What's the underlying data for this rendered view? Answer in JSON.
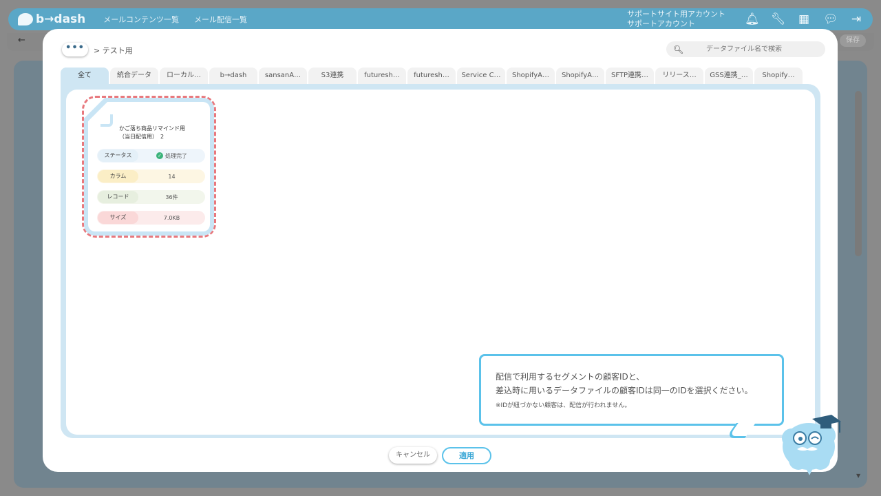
{
  "app": {
    "logo_text": "b→dash",
    "nav": [
      "メールコンテンツ一覧",
      "メール配信一覧"
    ],
    "account_line1": "サポートサイト用アカウント",
    "account_line2": "サポートアカウント",
    "save_label": "保存",
    "back_glyph": "←"
  },
  "modal": {
    "more_label": "•••",
    "breadcrumb": "> テスト用",
    "search_placeholder": "データファイル名で検索",
    "tabs": [
      "全て",
      "統合データ",
      "ローカル…",
      "b→dash",
      "sansanA…",
      "S3連携",
      "futuresh…",
      "futuresh…",
      "Service C…",
      "ShopifyA…",
      "ShopifyA…",
      "SFTP連携…",
      "リリース…",
      "GSS連携_…",
      "Shopify…"
    ],
    "active_tab": 0,
    "card": {
      "title_line1": "かご落ち商品リマインド用",
      "title_line2": "（当日配信用）　2",
      "rows": [
        {
          "label": "ステータス",
          "value": "処理完了",
          "label_bg": "#e4f0f8",
          "value_bg": "#eef5fb"
        },
        {
          "label": "カラム",
          "value": "14",
          "label_bg": "#fbeec6",
          "value_bg": "#fdf6e3"
        },
        {
          "label": "レコード",
          "value": "36件",
          "label_bg": "#e7efdf",
          "value_bg": "#f2f6ec"
        },
        {
          "label": "サイズ",
          "value": "7.0KB",
          "label_bg": "#fad8d8",
          "value_bg": "#fcebeb"
        }
      ]
    },
    "tooltip": {
      "line1": "配信で利用するセグメントの顧客IDと、",
      "line2": "差込時に用いるデータファイルの顧客IDは同一のIDを選択ください。",
      "note": "※IDが紐づかない顧客は、配信が行われません。"
    },
    "cancel_label": "キャンセル",
    "apply_label": "適用"
  }
}
